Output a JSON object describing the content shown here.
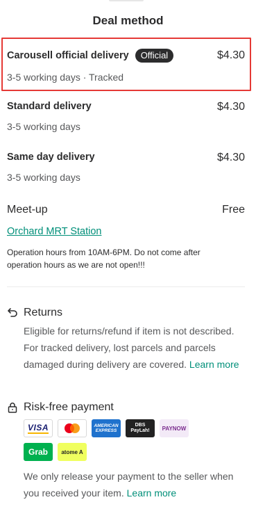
{
  "header": {
    "title": "Deal method"
  },
  "options": [
    {
      "name": "Carousell official delivery",
      "badge": "Official",
      "price": "$4.30",
      "sub": "3-5 working days  · Tracked"
    },
    {
      "name": "Standard delivery",
      "price": "$4.30",
      "sub": "3-5 working days"
    },
    {
      "name": "Same day delivery",
      "price": "$4.30",
      "sub": "3-5 working days"
    }
  ],
  "meetup": {
    "name": "Meet-up",
    "price": "Free",
    "location": "Orchard MRT Station",
    "note": "Operation hours from 10AM-6PM. Do not come after operation hours as we are not open!!!"
  },
  "returns": {
    "title": "Returns",
    "text": "Eligible for returns/refund if item is not described. For tracked delivery, lost parcels and parcels damaged during delivery are covered. ",
    "link": "Learn more"
  },
  "payment": {
    "title": "Risk-free payment",
    "methods_row1": [
      "VISA",
      "Mastercard",
      "AMERICAN EXPRESS",
      "DBS PayLah!",
      "PAYNOW"
    ],
    "methods_row2": [
      "Grab",
      "atome A"
    ],
    "text": "We only release your payment to the seller when you received your item. ",
    "link": "Learn more"
  },
  "colors": {
    "accent": "#008f79",
    "highlight": "#e53935",
    "text": "#2c2c2d"
  },
  "icons": {
    "returns": "return-arrow-icon",
    "payment": "lock-icon"
  }
}
